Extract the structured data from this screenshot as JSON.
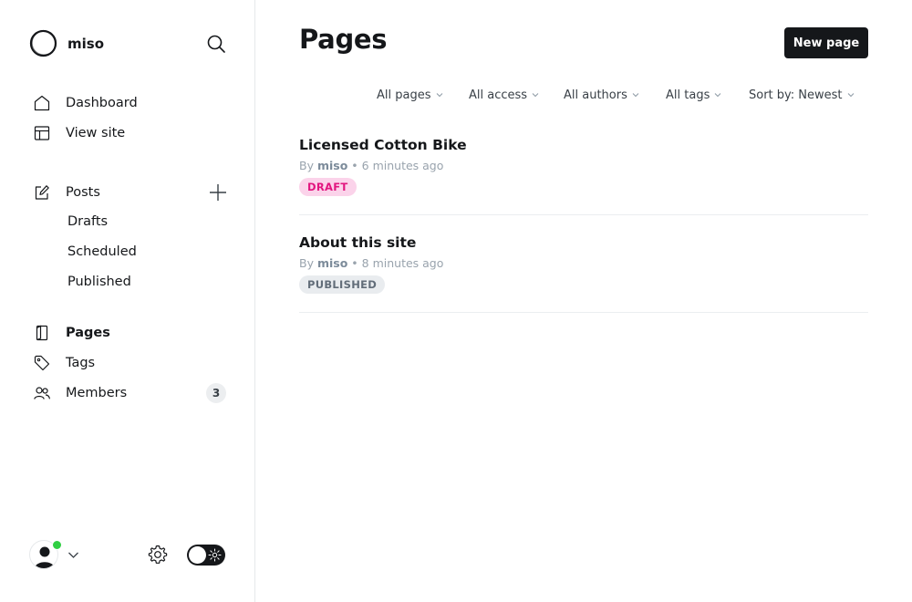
{
  "brand": {
    "name": "miso"
  },
  "sidebar": {
    "nav": [
      {
        "label": "Dashboard",
        "icon": "home-icon"
      },
      {
        "label": "View site",
        "icon": "layout-icon"
      }
    ],
    "posts": {
      "label": "Posts",
      "icon": "edit-icon",
      "sub_items": [
        "Drafts",
        "Scheduled",
        "Published"
      ]
    },
    "pages": {
      "label": "Pages",
      "icon": "page-icon",
      "active": true
    },
    "tags": {
      "label": "Tags",
      "icon": "tag-icon"
    },
    "members": {
      "label": "Members",
      "icon": "members-icon",
      "count": "3"
    }
  },
  "header": {
    "title": "Pages",
    "new_button": "New page"
  },
  "filters": {
    "type": "All pages",
    "access": "All access",
    "authors": "All authors",
    "tags": "All tags",
    "sort": "Sort by: Newest"
  },
  "items": [
    {
      "title": "Licensed Cotton Bike",
      "by": "By",
      "author": "miso",
      "time": "• 6 minutes ago",
      "status": "DRAFT"
    },
    {
      "title": "About this site",
      "by": "By",
      "author": "miso",
      "time": "• 8 minutes ago",
      "status": "PUBLISHED"
    }
  ],
  "colors": {
    "accent_dark": "#15171a",
    "draft_bg": "#fbd3ea",
    "draft_text": "#e2157f",
    "published_bg": "#e9ecef",
    "published_text": "#626d79",
    "online": "#30cf43"
  }
}
